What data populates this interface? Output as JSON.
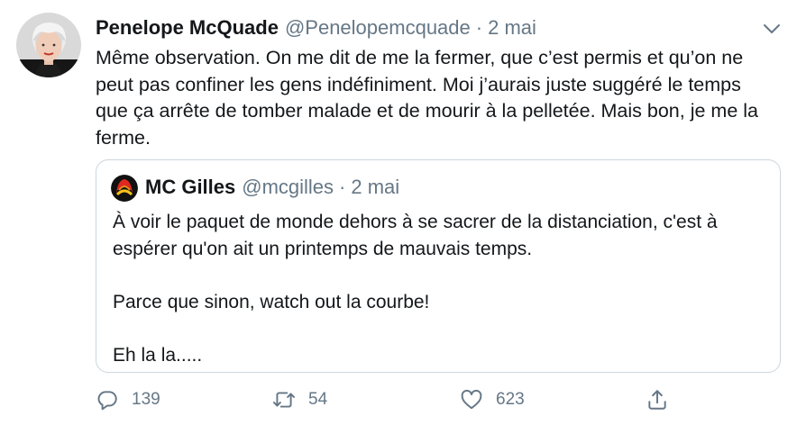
{
  "tweet": {
    "author_name": "Penelope McQuade",
    "author_handle": "@Penelopemcquade",
    "separator": "·",
    "date": "2 mai",
    "text": "Même observation. On me dit de me la fermer, que c’est permis et qu’on ne peut pas confiner les gens indéfiniment. Moi j’aurais juste suggéré le temps que ça arrête de tomber malade et de mourir à la pelletée. Mais bon, je me la ferme.",
    "avatar_icon": "avatar-photo",
    "menu_icon": "chevron-down-icon"
  },
  "quoted": {
    "author_name": "MC Gilles",
    "author_handle": "@mcgilles",
    "separator": "·",
    "date": "2 mai",
    "avatar_icon": "mc-gilles-logo",
    "paragraphs": [
      "À voir le paquet de monde dehors à se sacrer de la distanciation, c'est à espérer qu'on ait un printemps de mauvais temps.",
      "Parce que sinon, watch out la courbe!",
      "Eh la la....."
    ]
  },
  "actions": {
    "reply_count": "139",
    "retweet_count": "54",
    "like_count": "623",
    "reply_icon": "reply-icon",
    "retweet_icon": "retweet-icon",
    "like_icon": "heart-icon",
    "share_icon": "share-icon"
  },
  "colors": {
    "text": "#14171a",
    "secondary": "#657786",
    "border": "#ccd6dd",
    "background": "#ffffff"
  }
}
